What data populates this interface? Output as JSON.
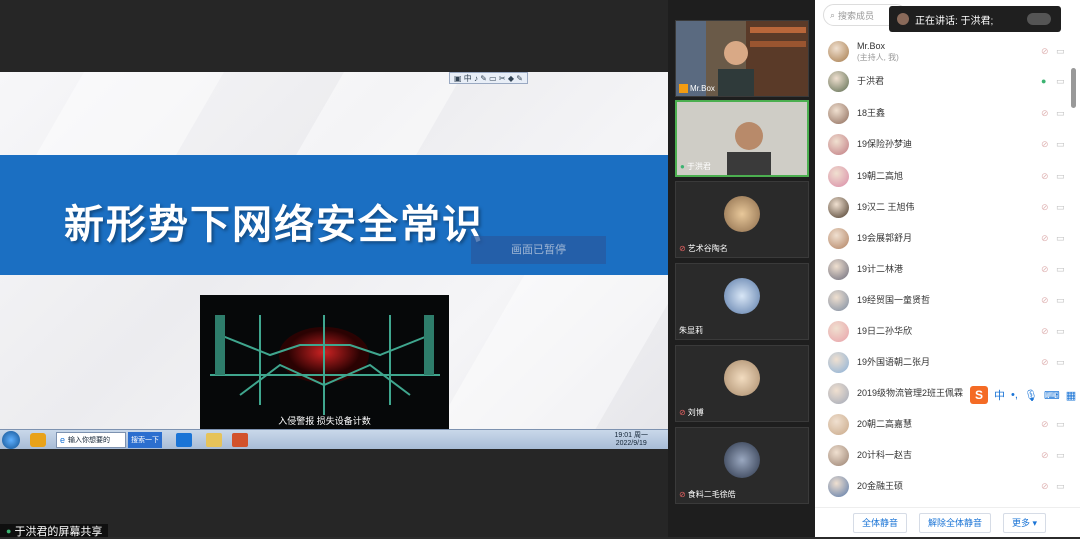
{
  "share": {
    "slide_title": "新形势下网络安全常识",
    "pause_badge": "画面已暂停",
    "video_caption": "入侵警报 损失设备计数",
    "share_label": "于洪君的屏幕共享",
    "toolbar_glyphs": "▣ 中 ♪ ✎ ▭ ✂ ◆ ✎",
    "taskbar": {
      "search_placeholder": "输入你想要的",
      "search_button": "搜索一下",
      "clock_time": "19:01 周一",
      "clock_date": "2022/9/19"
    }
  },
  "tiles": [
    {
      "name": "Mr.Box"
    },
    {
      "name": "于洪君"
    },
    {
      "name": "艺术谷陶名"
    },
    {
      "name": "朱显莉"
    },
    {
      "name": "刘博"
    },
    {
      "name": "食料二毛徐皓"
    }
  ],
  "sidebar": {
    "search_placeholder": "搜索成员",
    "speaking_prefix": "正在讲话: 于洪君;",
    "members": [
      {
        "name": "Mr.Box",
        "sub": "(主持人, 我)",
        "color": "#a57a4a"
      },
      {
        "name": "于洪君",
        "sub": "",
        "color": "#5a6b4f"
      },
      {
        "name": "18王鑫",
        "sub": "",
        "color": "#8c6a5a"
      },
      {
        "name": "19保险孙梦迪",
        "sub": "",
        "color": "#c07a82"
      },
      {
        "name": "19朝二高旭",
        "sub": "",
        "color": "#d98aa6"
      },
      {
        "name": "19汉二 王旭伟",
        "sub": "",
        "color": "#4a3a2a"
      },
      {
        "name": "19会展郭舒月",
        "sub": "",
        "color": "#b08060"
      },
      {
        "name": "19计二林港",
        "sub": "",
        "color": "#6a6a7a"
      },
      {
        "name": "19经贸国一童贤哲",
        "sub": "",
        "color": "#7a8aa0"
      },
      {
        "name": "19日二孙华欣",
        "sub": "",
        "color": "#e8a0a8"
      },
      {
        "name": "19外国语朝二张月",
        "sub": "",
        "color": "#88b0d8"
      },
      {
        "name": "2019级物流管理2班王佩霖",
        "sub": "",
        "color": "#a0a8b8"
      },
      {
        "name": "20朝二高嘉慧",
        "sub": "",
        "color": "#c8a888"
      },
      {
        "name": "20计科一赵吉",
        "sub": "",
        "color": "#988070"
      },
      {
        "name": "20金融王硕",
        "sub": "",
        "color": "#5878a8"
      }
    ],
    "bottom": {
      "mute_all": "全体静音",
      "unmute_all": "解除全体静音",
      "more": "更多 ▾"
    }
  },
  "ime": {
    "logo": "S",
    "label": "中"
  }
}
